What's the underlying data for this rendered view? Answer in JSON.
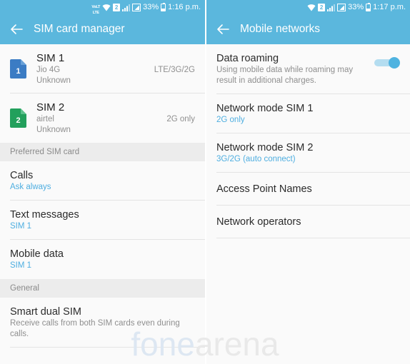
{
  "watermark": {
    "part1": "fone",
    "part2": "arena"
  },
  "left": {
    "statusbar": {
      "volte_line1": "VoLT",
      "volte_line2": "LTE",
      "wifi_icon": "wifi-icon",
      "sim2_label": "2",
      "signal_icon": "signal-bars-icon",
      "signal2_icon": "signal-strength-icon",
      "battery_percent": "33%",
      "battery_icon": "battery-icon",
      "time": "1:16 p.m."
    },
    "appbar": {
      "back_icon": "back-arrow-icon",
      "title": "SIM card manager"
    },
    "sims": [
      {
        "icon": "sim-card-icon",
        "number": "1",
        "color": "#3b7cc4",
        "title": "SIM 1",
        "carrier": "Jio 4G",
        "phone": "Unknown",
        "value": "LTE/3G/2G"
      },
      {
        "icon": "sim-card-icon",
        "number": "2",
        "color": "#22a05c",
        "title": "SIM 2",
        "carrier": "airtel",
        "phone": "Unknown",
        "value": "2G only"
      }
    ],
    "section_preferred": "Preferred SIM card",
    "preferred_items": [
      {
        "title": "Calls",
        "sub": "Ask always"
      },
      {
        "title": "Text messages",
        "sub": "SIM 1"
      },
      {
        "title": "Mobile data",
        "sub": "SIM 1"
      }
    ],
    "section_general": "General",
    "general_items": [
      {
        "title": "Smart dual SIM",
        "sub": "Receive calls from both SIM cards even during calls."
      }
    ]
  },
  "right": {
    "statusbar": {
      "wifi_icon": "wifi-icon",
      "sim2_label": "2",
      "signal_icon": "signal-bars-icon",
      "signal2_icon": "signal-strength-icon",
      "battery_percent": "33%",
      "battery_icon": "battery-icon",
      "time": "1:17 p.m."
    },
    "appbar": {
      "back_icon": "back-arrow-icon",
      "title": "Mobile networks"
    },
    "roaming": {
      "title": "Data roaming",
      "sub": "Using mobile data while roaming may result in additional charges.",
      "toggle_on": true
    },
    "items": [
      {
        "title": "Network mode SIM 1",
        "sub": "2G only"
      },
      {
        "title": "Network mode SIM 2",
        "sub": "3G/2G (auto connect)"
      },
      {
        "title": "Access Point Names",
        "sub": ""
      },
      {
        "title": "Network operators",
        "sub": ""
      }
    ]
  },
  "colors": {
    "accent": "#5bb7dd",
    "link": "#4eaee0",
    "sim1": "#3b7cc4",
    "sim2": "#22a05c"
  }
}
